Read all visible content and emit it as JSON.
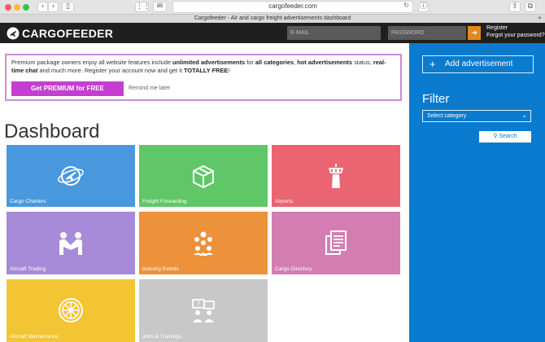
{
  "browser": {
    "url": "cargofeeder.com",
    "tab_title": "Cargofeeder - Air and cargo freight advertisements dashboard"
  },
  "header": {
    "logo_text": "CARGOFEEDER",
    "email_placeholder": "E-MAIL",
    "password_placeholder": "PASSWORD",
    "register_label": "Register",
    "forgot_label": "Forgot your password?",
    "login_color": "#e48a1c"
  },
  "promo": {
    "t1": "Premium package owners enjoy all website features include ",
    "b1": "unlimited advertisements",
    "t2": " for ",
    "b2": "all categories",
    "t3": ", ",
    "b3": "hot advertisements",
    "t4": " status, ",
    "b4": "real-time chat",
    "t5": " and much more. Register your account now and get it ",
    "b5": "TOTALLY FREE",
    "t6": "!",
    "premium_button": "Get PREMIUM for FREE",
    "remind_link": "Remind me later"
  },
  "page_title": "Dashboard",
  "tiles": [
    {
      "label": "Cargo Charters",
      "icon": "plane-globe-icon",
      "color": "#4a98dd"
    },
    {
      "label": "Freight Forwarding",
      "icon": "box-icon",
      "color": "#5fc767"
    },
    {
      "label": "Airports",
      "icon": "control-tower-icon",
      "color": "#ea6471"
    },
    {
      "label": "Aircraft Trading",
      "icon": "handshake-icon",
      "color": "#a78bd8"
    },
    {
      "label": "Industry Events",
      "icon": "people-group-icon",
      "color": "#ed913b"
    },
    {
      "label": "Cargo Directory",
      "icon": "documents-icon",
      "color": "#d37db2"
    },
    {
      "label": "Aircraft Maintenance",
      "icon": "engine-icon",
      "color": "#f3c534"
    },
    {
      "label": "Jobs & Trainings",
      "icon": "job-icon",
      "color": "#c8c8c8"
    }
  ],
  "sidebar": {
    "add_ad_label": "Add advertisement",
    "filter_title": "Filter",
    "select_value": "Select category",
    "search_label": "Search",
    "color": "#0a7bcf"
  }
}
